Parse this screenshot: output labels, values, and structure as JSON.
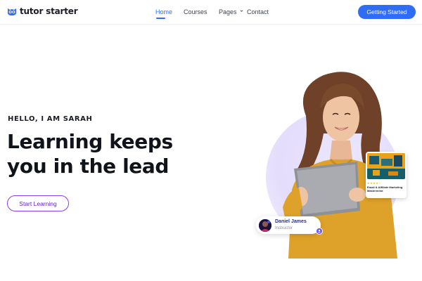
{
  "brand": {
    "name": "tutor starter"
  },
  "nav": {
    "items": [
      {
        "label": "Home",
        "active": true
      },
      {
        "label": "Courses",
        "active": false
      },
      {
        "label": "Pages",
        "active": false,
        "has_dropdown": true
      },
      {
        "label": "Contact",
        "active": false
      }
    ],
    "cta_label": "Getting Started"
  },
  "hero": {
    "eyebrow": "HELLO, I AM SARAH",
    "headline_line1": "Learning keeps",
    "headline_line2": "you in the lead",
    "button_label": "Start Learning"
  },
  "course_card": {
    "rating": "★★★★☆",
    "title": "Email & Affiliate Marketing Mastermind"
  },
  "instructor": {
    "name": "Daniel James",
    "role": "Instructor"
  },
  "colors": {
    "accent": "#2f6df5",
    "outline_button": "#8a3ff0",
    "sweater": "#e2a52a",
    "blob": "#e4ddfb"
  },
  "icons": [
    "owl-logo-icon",
    "chevron-down-icon",
    "verified-badge-icon"
  ]
}
